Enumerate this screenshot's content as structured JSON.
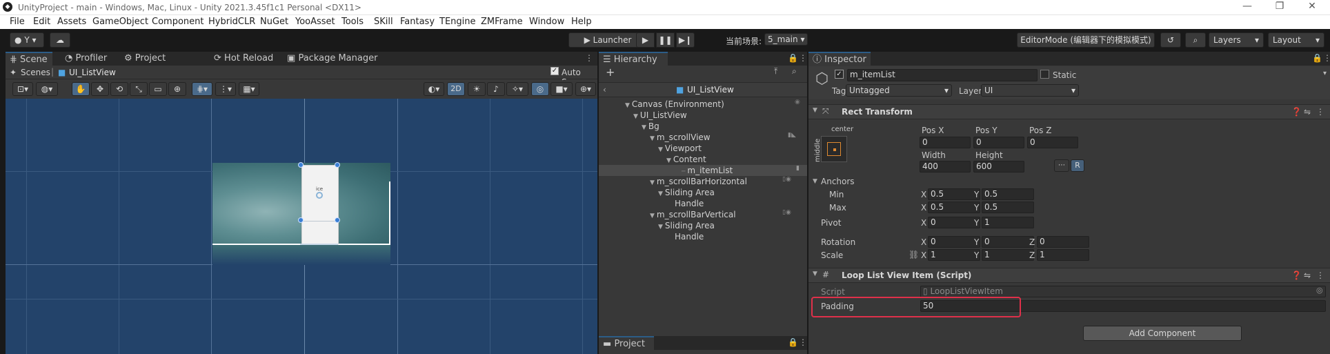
{
  "window": {
    "title": "UnityProject - main - Windows, Mac, Linux - Unity 2021.3.45f1c1 Personal <DX11>"
  },
  "menu": [
    "File",
    "Edit",
    "Assets",
    "GameObject",
    "Component",
    "HybridCLR",
    "NuGet",
    "YooAsset",
    "Tools",
    "SKill",
    "Fantasy",
    "TEngine",
    "ZMFrame",
    "Window",
    "Help"
  ],
  "toolbar": {
    "account": "Y",
    "launcher": "Launcher",
    "scene_label": "当前场景:",
    "scene_value": "5_main",
    "editor_mode": "EditorMode (编辑器下的模拟模式)",
    "layers": "Layers",
    "layout": "Layout"
  },
  "scene_tabs": [
    {
      "label": "Scene"
    },
    {
      "label": "Profiler"
    },
    {
      "label": "Project Settings"
    },
    {
      "label": "Hot Reload"
    },
    {
      "label": "Package Manager"
    }
  ],
  "scene": {
    "breadcrumb_root": "Scenes",
    "breadcrumb_current": "UI_ListView",
    "auto_save": "Auto Save",
    "mode_2d": "2D",
    "item_text": "ice"
  },
  "hierarchy": {
    "tab": "Hierarchy",
    "prefab_title": "UI_ListView",
    "rows": [
      {
        "label": "Canvas (Environment)",
        "depth": 0,
        "arrow": true
      },
      {
        "label": "UI_ListView",
        "depth": 1,
        "arrow": true
      },
      {
        "label": "Bg",
        "depth": 2,
        "arrow": true
      },
      {
        "label": "m_scrollView",
        "depth": 3,
        "arrow": true
      },
      {
        "label": "Viewport",
        "depth": 4,
        "arrow": true
      },
      {
        "label": "Content",
        "depth": 5,
        "arrow": true
      },
      {
        "label": "m_itemList",
        "depth": 6,
        "arrow": false,
        "selected": true
      },
      {
        "label": "m_scrollBarHorizontal",
        "depth": 3,
        "arrow": true
      },
      {
        "label": "Sliding Area",
        "depth": 4,
        "arrow": true
      },
      {
        "label": "Handle",
        "depth": 5,
        "arrow": false
      },
      {
        "label": "m_scrollBarVertical",
        "depth": 3,
        "arrow": true
      },
      {
        "label": "Sliding Area",
        "depth": 4,
        "arrow": true
      },
      {
        "label": "Handle",
        "depth": 5,
        "arrow": false
      }
    ]
  },
  "project": {
    "tab": "Project"
  },
  "inspector": {
    "tab": "Inspector",
    "object_name": "m_itemList",
    "static": "Static",
    "tag_label": "Tag",
    "tag_value": "Untagged",
    "layer_label": "Layer",
    "layer_value": "UI",
    "rect_transform": {
      "title": "Rect Transform",
      "anchor_h": "center",
      "anchor_v": "middle",
      "pos_x_label": "Pos X",
      "pos_x": "0",
      "pos_y_label": "Pos Y",
      "pos_y": "0",
      "pos_z_label": "Pos Z",
      "pos_z": "0",
      "width_label": "Width",
      "width": "400",
      "height_label": "Height",
      "height": "600",
      "r_button": "R",
      "anchors_label": "Anchors",
      "min_label": "Min",
      "min_x": "0.5",
      "min_y": "0.5",
      "max_label": "Max",
      "max_x": "0.5",
      "max_y": "0.5",
      "pivot_label": "Pivot",
      "pivot_x": "0",
      "pivot_y": "1",
      "rotation_label": "Rotation",
      "rot_x": "0",
      "rot_y": "0",
      "rot_z": "0",
      "scale_label": "Scale",
      "scale_x": "1",
      "scale_y": "1",
      "scale_z": "1",
      "x": "X",
      "y": "Y",
      "z": "Z"
    },
    "loop_item": {
      "title": "Loop List View Item (Script)",
      "script_label": "Script",
      "script_value": "LoopListViewItem",
      "padding_label": "Padding",
      "padding_value": "50"
    },
    "add_component": "Add Component"
  },
  "colors": {
    "highlight": "#e0304a",
    "selection": "#2c5d87",
    "scene_bg": "#23436a"
  }
}
